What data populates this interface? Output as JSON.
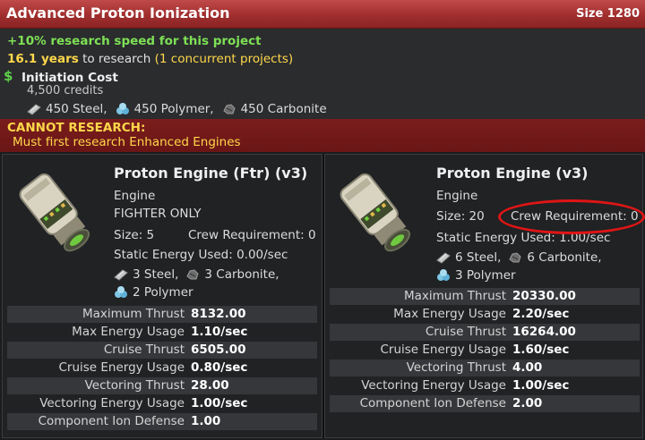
{
  "header": {
    "title": "Advanced Proton Ionization",
    "size_label": "Size 1280"
  },
  "research": {
    "bonus": "+10% research speed for this project",
    "years": "16.1 years",
    "time_suffix_1": " to research ",
    "concurrent": "(1 concurrent projects)",
    "cost_label": "Initiation Cost",
    "credits": "4,500 credits",
    "res_steel": "450 Steel,",
    "res_polymer": "450 Polymer,",
    "res_carbonite": "450 Carbonite",
    "currency_symbol": "$"
  },
  "warning": {
    "head": "CANNOT RESEARCH:",
    "body": "Must first research Enhanced Engines"
  },
  "left": {
    "name": "Proton Engine (Ftr) (v3)",
    "type": "Engine",
    "restriction": "FIGHTER ONLY",
    "size": "Size: 5",
    "crew": "Crew Requirement: 0",
    "static_energy": "Static Energy Used: 0.00/sec",
    "steel": "3 Steel,",
    "carbonite": "3 Carbonite,",
    "polymer": "2 Polymer",
    "stats": [
      {
        "label": "Maximum Thrust",
        "value": "8132.00"
      },
      {
        "label": "Max Energy Usage",
        "value": "1.10/sec"
      },
      {
        "label": "Cruise Thrust",
        "value": "6505.00"
      },
      {
        "label": "Cruise Energy Usage",
        "value": "0.80/sec"
      },
      {
        "label": "Vectoring Thrust",
        "value": "28.00"
      },
      {
        "label": "Vectoring Energy Usage",
        "value": "1.00/sec"
      },
      {
        "label": "Component Ion Defense",
        "value": "1.00"
      }
    ]
  },
  "right": {
    "name": "Proton Engine (v3)",
    "type": "Engine",
    "size": "Size: 20",
    "crew": "Crew Requirement: 0",
    "static_energy": "Static Energy Used: 1.00/sec",
    "steel": "6 Steel,",
    "carbonite": "6 Carbonite,",
    "polymer": "3 Polymer",
    "stats": [
      {
        "label": "Maximum Thrust",
        "value": "20330.00"
      },
      {
        "label": "Max Energy Usage",
        "value": "2.20/sec"
      },
      {
        "label": "Cruise Thrust",
        "value": "16264.00"
      },
      {
        "label": "Cruise Energy Usage",
        "value": "1.60/sec"
      },
      {
        "label": "Vectoring Thrust",
        "value": "4.00"
      },
      {
        "label": "Vectoring Energy Usage",
        "value": "1.00/sec"
      },
      {
        "label": "Component Ion Defense",
        "value": "2.00"
      }
    ]
  },
  "colors": {
    "title_bar": "#a12e2e",
    "bonus_text": "#7ee055",
    "highlight_text": "#ffd84a",
    "warning_bg": "#6a1616",
    "annotation_ellipse": "#e01515"
  },
  "icons": {
    "steel": "steel-ingot-icon",
    "polymer": "polymer-blob-icon",
    "carbonite": "carbonite-rock-icon",
    "engine": "engine-component-icon"
  }
}
